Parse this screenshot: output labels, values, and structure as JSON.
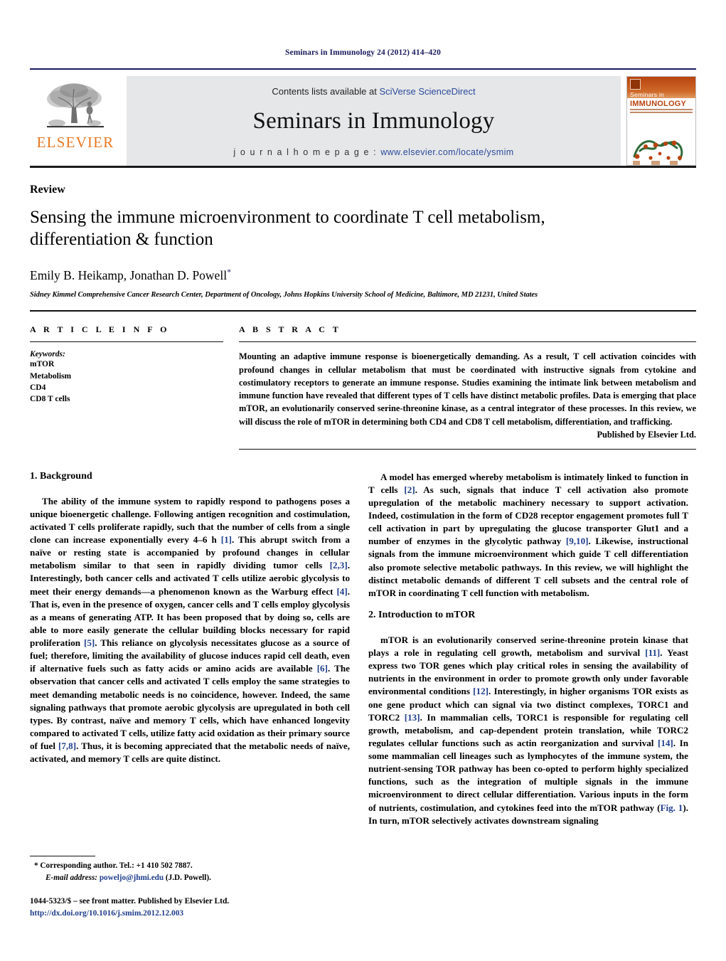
{
  "running_head": "Seminars in Immunology 24 (2012) 414–420",
  "masthead": {
    "publisher_name": "ELSEVIER",
    "publisher_logo_icon": "elsevier-tree-icon",
    "contents_prefix": "Contents lists available at ",
    "contents_link": "SciVerse ScienceDirect",
    "journal_name": "Seminars in Immunology",
    "homepage_label": "j o u r n a l   h o m e p a g e :",
    "homepage_url": "www.elsevier.com/locate/ysmim",
    "cover": {
      "badge_icon": "journal-crest-icon",
      "kicker": "Seminars in",
      "title": "IMMUNOLOGY",
      "art_icon": "protein-structure-icon"
    }
  },
  "article": {
    "doctype": "Review",
    "title": "Sensing the immune microenvironment to coordinate T cell metabolism, differentiation & function",
    "authors": "Emily B. Heikamp, Jonathan D. Powell",
    "corresponding_marker": "*",
    "affiliation": "Sidney Kimmel Comprehensive Cancer Research Center, Department of Oncology, Johns Hopkins University School of Medicine, Baltimore, MD 21231, United States"
  },
  "article_info": {
    "heading": "A R T I C L E   I N F O",
    "keywords_label": "Keywords:",
    "keywords": [
      "mTOR",
      "Metabolism",
      "CD4",
      "CD8 T cells"
    ]
  },
  "abstract": {
    "heading": "A B S T R A C T",
    "text": "Mounting an adaptive immune response is bioenergetically demanding. As a result, T cell activation coincides with profound changes in cellular metabolism that must be coordinated with instructive signals from cytokine and costimulatory receptors to generate an immune response. Studies examining the intimate link between metabolism and immune function have revealed that different types of T cells have distinct metabolic profiles. Data is emerging that place mTOR, an evolutionarily conserved serine-threonine kinase, as a central integrator of these processes. In this review, we will discuss the role of mTOR in determining both CD4 and CD8 T cell metabolism, differentiation, and trafficking.",
    "published_by": "Published by Elsevier Ltd."
  },
  "sections": {
    "background": {
      "number": "1.",
      "heading": "Background",
      "paragraphs": [
        "The ability of the immune system to rapidly respond to pathogens poses a unique bioenergetic challenge. Following antigen recognition and costimulation, activated T cells proliferate rapidly, such that the number of cells from a single clone can increase exponentially every 4–6 h [1]. This abrupt switch from a naïve or resting state is accompanied by profound changes in cellular metabolism similar to that seen in rapidly dividing tumor cells [2,3]. Interestingly, both cancer cells and activated T cells utilize aerobic glycolysis to meet their energy demands—a phenomenon known as the Warburg effect [4]. That is, even in the presence of oxygen, cancer cells and T cells employ glycolysis as a means of generating ATP. It has been proposed that by doing so, cells are able to more easily generate the cellular building blocks necessary for rapid proliferation [5]. This reliance on glycolysis necessitates glucose as a source of fuel; therefore, limiting the availability of glucose induces rapid cell death, even if alternative fuels such as fatty acids or amino acids are available [6]. The observation that cancer cells and activated T cells employ the same strategies to meet demanding metabolic needs is no coincidence, however. Indeed, the same signaling pathways that promote aerobic glycolysis are upregulated in both cell types. By contrast, naïve and memory T cells, which have enhanced longevity compared to activated T cells, utilize fatty acid oxidation as their primary source of fuel [7,8]. Thus, it is becoming appreciated that the metabolic needs of naïve, activated, and memory T cells are quite distinct.",
        "A model has emerged whereby metabolism is intimately linked to function in T cells [2]. As such, signals that induce T cell activation also promote upregulation of the metabolic machinery necessary to support activation. Indeed, costimulation in the form of CD28 receptor engagement promotes full T cell activation in part by upregulating the glucose transporter Glut1 and a number of enzymes in the glycolytic pathway [9,10]. Likewise, instructional signals from the immune microenvironment which guide T cell differentiation also promote selective metabolic pathways. In this review, we will highlight the distinct metabolic demands of different T cell subsets and the central role of mTOR in coordinating T cell function with metabolism."
      ]
    },
    "intro_mtor": {
      "number": "2.",
      "heading": "Introduction to mTOR",
      "paragraphs": [
        "mTOR is an evolutionarily conserved serine-threonine protein kinase that plays a role in regulating cell growth, metabolism and survival [11]. Yeast express two TOR genes which play critical roles in sensing the availability of nutrients in the environment in order to promote growth only under favorable environmental conditions [12]. Interestingly, in higher organisms TOR exists as one gene product which can signal via two distinct complexes, TORC1 and TORC2 [13]. In mammalian cells, TORC1 is responsible for regulating cell growth, metabolism, and cap-dependent protein translation, while TORC2 regulates cellular functions such as actin reorganization and survival [14]. In some mammalian cell lineages such as lymphocytes of the immune system, the nutrient-sensing TOR pathway has been co-opted to perform highly specialized functions, such as the integration of multiple signals in the immune microenvironment to direct cellular differentiation. Various inputs in the form of nutrients, costimulation, and cytokines feed into the mTOR pathway (Fig. 1). In turn, mTOR selectively activates downstream signaling"
      ]
    }
  },
  "footnote": {
    "marker": "*",
    "corresponding_text": "Corresponding author. Tel.: +1 410 502 7887.",
    "email_label": "E-mail address:",
    "email": "poweljo@jhmi.edu",
    "email_suffix": "(J.D. Powell).",
    "front_matter": "1044-5323/$ – see front matter. Published by Elsevier Ltd.",
    "doi_url": "http://dx.doi.org/10.1016/j.smim.2012.12.003"
  },
  "colors": {
    "link_blue": "#1f3d8c",
    "elsevier_orange": "#E87722",
    "cover_orange": "#b8430f",
    "band_gray": "#e6e7e8"
  }
}
